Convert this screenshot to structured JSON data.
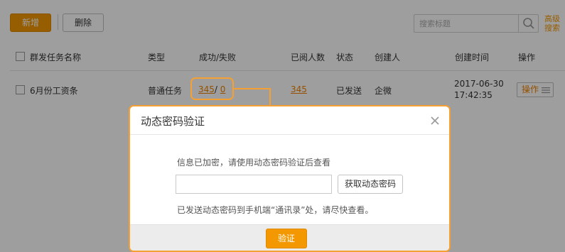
{
  "toolbar": {
    "add_label": "新增",
    "delete_label": "删除",
    "search_placeholder": "搜索标题",
    "advanced_search_line1": "高级",
    "advanced_search_line2": "搜索",
    "search_icon": "search-icon"
  },
  "table": {
    "columns": [
      "群发任务名称",
      "类型",
      "成功/失败",
      "已阅人数",
      "状态",
      "创建人",
      "创建时间",
      "操作"
    ],
    "rows": [
      {
        "name": "6月份工资条",
        "type": "普通任务",
        "success": "345",
        "separator": "/",
        "fail": "0",
        "read_count": "345",
        "status": "已发送",
        "creator": "企微",
        "created_date": "2017-06-30",
        "created_time": "17:42:35",
        "action_label": "操作",
        "action_icon": "menu-icon"
      }
    ]
  },
  "dialog": {
    "title": "动态密码验证",
    "message": "信息已加密，请使用动态密码验证后查看",
    "code_value": "",
    "get_code_label": "获取动态密码",
    "note": "已发送动态密码到手机端“通讯录”处，请尽快查看。",
    "verify_label": "验证",
    "close_icon": "close-icon"
  },
  "colors": {
    "accent": "#f39800",
    "link": "#f08300",
    "highlight_border": "#f5a033"
  }
}
